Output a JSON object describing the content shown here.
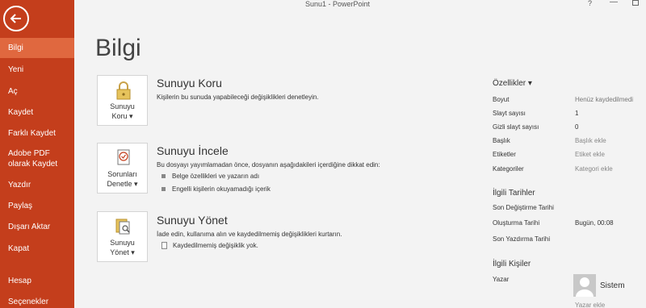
{
  "window": {
    "title": "Sunu1 - PowerPoint",
    "help": "?",
    "minimize": "—"
  },
  "sidebar": {
    "items": [
      {
        "label": "Bilgi"
      },
      {
        "label": "Yeni"
      },
      {
        "label": "Aç"
      },
      {
        "label": "Kaydet"
      },
      {
        "label": "Farklı Kaydet"
      },
      {
        "label": "Adobe PDF olarak Kaydet"
      },
      {
        "label": "Yazdır"
      },
      {
        "label": "Paylaş"
      },
      {
        "label": "Dışarı Aktar"
      },
      {
        "label": "Kapat"
      },
      {
        "label": "Hesap"
      },
      {
        "label": "Seçenekler"
      }
    ]
  },
  "page_title": "Bilgi",
  "protect": {
    "button_line1": "Sunuyu",
    "button_line2": "Koru ▾",
    "title": "Sunuyu Koru",
    "desc": "Kişilerin bu sunuda yapabileceği değişiklikleri denetleyin."
  },
  "inspect": {
    "button_line1": "Sorunları",
    "button_line2": "Denetle ▾",
    "title": "Sunuyu İncele",
    "desc": "Bu dosyayı yayımlamadan önce, dosyanın aşağıdakileri içerdiğine dikkat edin:",
    "bullets": [
      "Belge özellikleri ve yazarın adı",
      "Engelli kişilerin okuyamadığı içerik"
    ]
  },
  "manage": {
    "button_line1": "Sunuyu",
    "button_line2": "Yönet ▾",
    "title": "Sunuyu Yönet",
    "desc": "İade edin, kullanıma alın ve kaydedilmemiş değişiklikleri kurtarın.",
    "item": "Kaydedilmemiş değişiklik yok."
  },
  "properties": {
    "header": "Özellikler ▾",
    "rows": [
      {
        "label": "Boyut",
        "value": "Henüz kaydedilmedi"
      },
      {
        "label": "Slayt sayısı",
        "value": "1"
      },
      {
        "label": "Gizli slayt sayısı",
        "value": "0"
      },
      {
        "label": "Başlık",
        "value": "Başlık ekle"
      },
      {
        "label": "Etiketler",
        "value": "Etiket ekle"
      },
      {
        "label": "Kategoriler",
        "value": "Kategori ekle"
      }
    ]
  },
  "dates": {
    "header": "İlgili Tarihler",
    "rows": [
      {
        "label": "Son Değiştirme Tarihi",
        "value": ""
      },
      {
        "label": "Oluşturma Tarihi",
        "value": "Bugün, 00:08"
      },
      {
        "label": "Son Yazdırma Tarihi",
        "value": ""
      }
    ]
  },
  "people": {
    "header": "İlgili Kişiler",
    "author_label": "Yazar",
    "author_name": "Sistem",
    "add_author": "Yazar ekle"
  }
}
